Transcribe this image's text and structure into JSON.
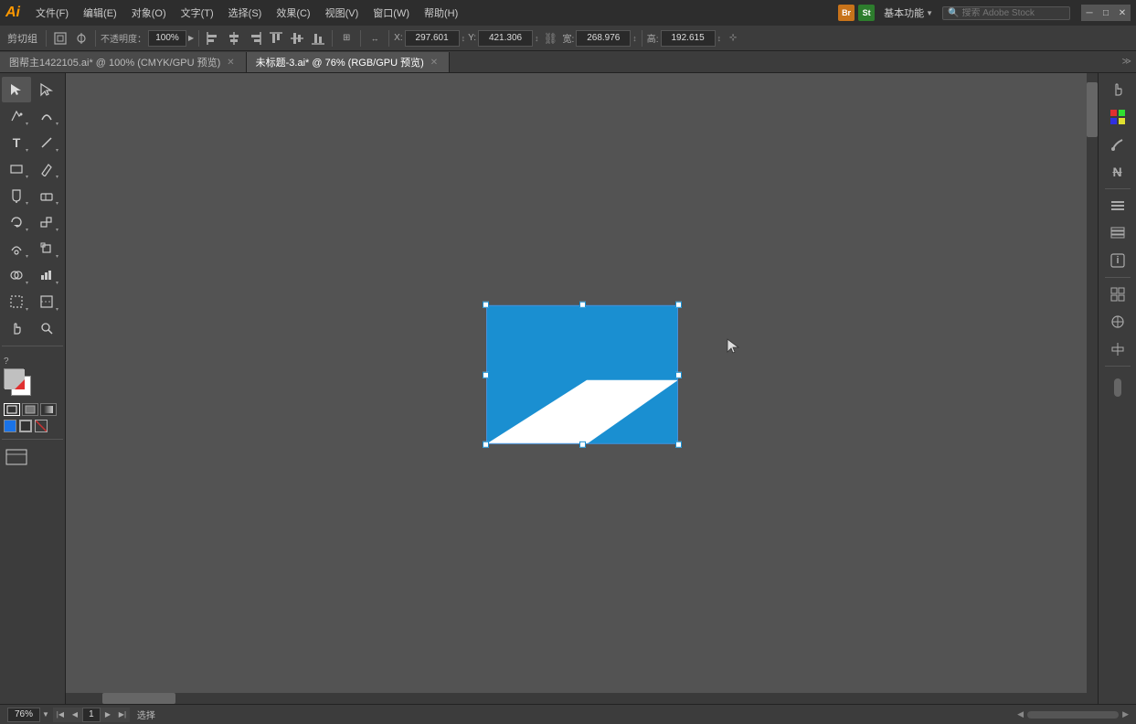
{
  "app": {
    "logo": "Ai",
    "title": "Adobe Illustrator"
  },
  "menubar": {
    "items": [
      {
        "label": "文件(F)"
      },
      {
        "label": "编辑(E)"
      },
      {
        "label": "对象(O)"
      },
      {
        "label": "文字(T)"
      },
      {
        "label": "选择(S)"
      },
      {
        "label": "效果(C)"
      },
      {
        "label": "视图(V)"
      },
      {
        "label": "窗口(W)"
      },
      {
        "label": "帮助(H)"
      }
    ],
    "workspace": "基本功能",
    "search_placeholder": "搜索 Adobe Stock",
    "bridge_label": "Br",
    "stock_label": "St"
  },
  "toolbar": {
    "label": "剪切组",
    "opacity_label": "不透明度：",
    "opacity_value": "100%",
    "x_label": "X:",
    "x_value": "297.601",
    "y_label": "Y:",
    "y_value": "421.306",
    "w_label": "宽:",
    "w_value": "268.976",
    "h_label": "高:",
    "h_value": "192.615"
  },
  "tabs": [
    {
      "label": "图帮主1422105.ai* @ 100% (CMYK/GPU 预览)",
      "active": false
    },
    {
      "label": "未标题-3.ai* @ 76% (RGB/GPU 预览)",
      "active": true
    }
  ],
  "statusbar": {
    "zoom_value": "76%",
    "page_value": "1",
    "status_label": "选择"
  },
  "canvas": {
    "bg_color": "#535353"
  },
  "artwork": {
    "fill_color": "#1a8fd1",
    "accent_color": "#ffffff"
  }
}
